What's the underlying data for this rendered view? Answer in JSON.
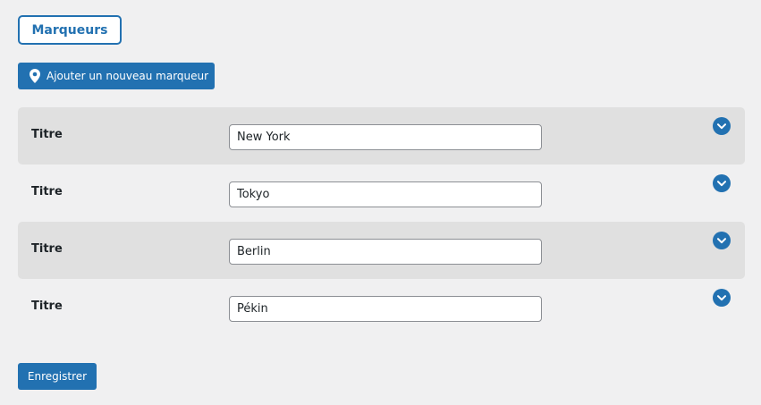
{
  "tab": {
    "label": "Marqueurs"
  },
  "toolbar": {
    "add_label": "Ajouter un nouveau marqueur",
    "add_icon": "map-pin-icon"
  },
  "markers": [
    {
      "label": "Titre",
      "value": "New York",
      "shaded": true
    },
    {
      "label": "Titre",
      "value": "Tokyo",
      "shaded": false
    },
    {
      "label": "Titre",
      "value": "Berlin",
      "shaded": true
    },
    {
      "label": "Titre",
      "value": "Pékin",
      "shaded": false
    }
  ],
  "save": {
    "label": "Enregistrer"
  },
  "colors": {
    "accent": "#2271b1",
    "background": "#f0f0f1",
    "row_shade": "#e0e0e0"
  },
  "icons": {
    "toggle": "chevron-down-icon"
  }
}
